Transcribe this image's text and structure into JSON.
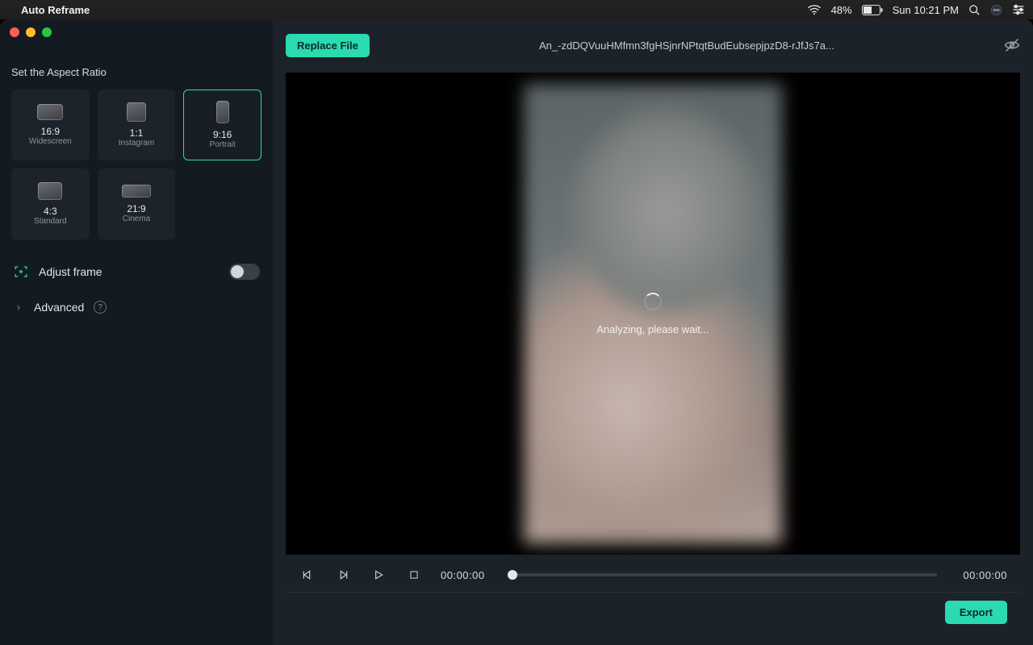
{
  "menubar": {
    "app_name": "Auto Reframe",
    "battery": "48%",
    "clock": "Sun 10:21 PM"
  },
  "window": {
    "section_title": "Set the Aspect Ratio",
    "ratios": [
      {
        "name": "16:9",
        "sub": "Widescreen",
        "thumb": "thumb-16x9",
        "selected": false
      },
      {
        "name": "1:1",
        "sub": "Instagram",
        "thumb": "thumb-1x1",
        "selected": false
      },
      {
        "name": "9:16",
        "sub": "Portrait",
        "thumb": "thumb-9x16",
        "selected": true
      },
      {
        "name": "4:3",
        "sub": "Standard",
        "thumb": "thumb-4x3",
        "selected": false
      },
      {
        "name": "21:9",
        "sub": "Cinema",
        "thumb": "thumb-21x9",
        "selected": false
      }
    ],
    "adjust_label": "Adjust frame",
    "adjust_on": false,
    "advanced_label": "Advanced"
  },
  "header": {
    "replace_label": "Replace File",
    "file_title": "An_-zdDQVuuHMfmn3fgHSjnrNPtqtBudEubsepjpzD8-rJfJs7a..."
  },
  "preview": {
    "analyzing_text": "Analyzing, please wait..."
  },
  "transport": {
    "time_current": "00:00:00",
    "time_total": "00:00:00"
  },
  "footer": {
    "export_label": "Export"
  }
}
